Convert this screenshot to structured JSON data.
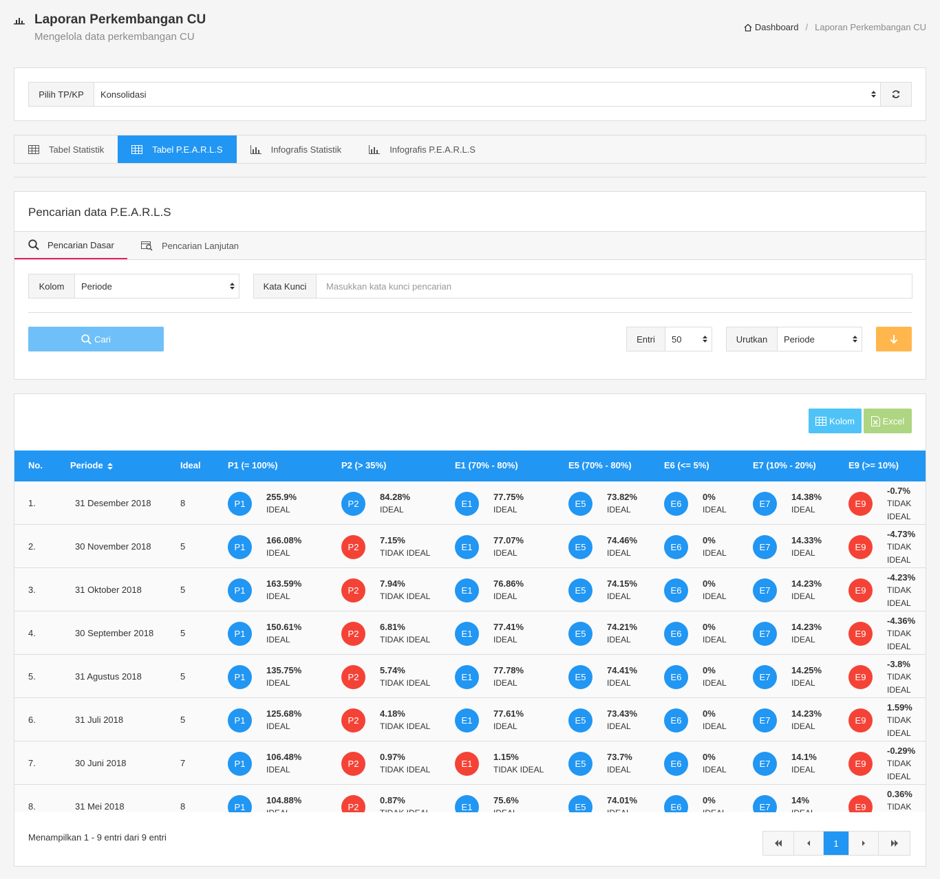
{
  "header": {
    "title": "Laporan Perkembangan CU",
    "subtitle": "Mengelola data perkembangan CU",
    "breadcrumb": {
      "home": "Dashboard",
      "current": "Laporan Perkembangan CU"
    }
  },
  "tpkp": {
    "label": "Pilih TP/KP",
    "value": "Konsolidasi"
  },
  "tabs": [
    {
      "label": "Tabel Statistik"
    },
    {
      "label": "Tabel P.E.A.R.L.S"
    },
    {
      "label": "Infografis Statistik"
    },
    {
      "label": "Infografis P.E.A.R.L.S"
    }
  ],
  "search": {
    "title": "Pencarian data P.E.A.R.L.S",
    "tab_basic": "Pencarian Dasar",
    "tab_advanced": "Pencarian Lanjutan",
    "kolom_label": "Kolom",
    "kolom_value": "Periode",
    "kata_label": "Kata Kunci",
    "kata_placeholder": "Masukkan kata kunci pencarian",
    "cari_label": "Cari",
    "entri_label": "Entri",
    "entri_value": "50",
    "urut_label": "Urutkan",
    "urut_value": "Periode"
  },
  "table": {
    "btn_kolom": "Kolom",
    "btn_excel": "Excel",
    "headers": {
      "no": "No.",
      "periode": "Periode",
      "ideal": "Ideal",
      "p1": "P1 (= 100%)",
      "p2": "P2 (> 35%)",
      "e1": "E1 (70% - 80%)",
      "e5": "E5 (70% - 80%)",
      "e6": "E6 (<= 5%)",
      "e7": "E7 (10% - 20%)",
      "e9": "E9 (>= 10%)"
    },
    "rows": [
      {
        "no": "1.",
        "periode": "31 Desember 2018",
        "ideal": "8",
        "ind": [
          [
            "P1",
            "255.9%",
            "IDEAL"
          ],
          [
            "P2",
            "84.28%",
            "IDEAL"
          ],
          [
            "E1",
            "77.75%",
            "IDEAL"
          ],
          [
            "E5",
            "73.82%",
            "IDEAL"
          ],
          [
            "E6",
            "0%",
            "IDEAL"
          ],
          [
            "E7",
            "14.38%",
            "IDEAL"
          ],
          [
            "E9",
            "-0.7%",
            "TIDAK IDEAL"
          ]
        ]
      },
      {
        "no": "2.",
        "periode": "30 November 2018",
        "ideal": "5",
        "ind": [
          [
            "P1",
            "166.08%",
            "IDEAL"
          ],
          [
            "P2",
            "7.15%",
            "TIDAK IDEAL"
          ],
          [
            "E1",
            "77.07%",
            "IDEAL"
          ],
          [
            "E5",
            "74.46%",
            "IDEAL"
          ],
          [
            "E6",
            "0%",
            "IDEAL"
          ],
          [
            "E7",
            "14.33%",
            "IDEAL"
          ],
          [
            "E9",
            "-4.73%",
            "TIDAK IDEAL"
          ]
        ]
      },
      {
        "no": "3.",
        "periode": "31 Oktober 2018",
        "ideal": "5",
        "ind": [
          [
            "P1",
            "163.59%",
            "IDEAL"
          ],
          [
            "P2",
            "7.94%",
            "TIDAK IDEAL"
          ],
          [
            "E1",
            "76.86%",
            "IDEAL"
          ],
          [
            "E5",
            "74.15%",
            "IDEAL"
          ],
          [
            "E6",
            "0%",
            "IDEAL"
          ],
          [
            "E7",
            "14.23%",
            "IDEAL"
          ],
          [
            "E9",
            "-4.23%",
            "TIDAK IDEAL"
          ]
        ]
      },
      {
        "no": "4.",
        "periode": "30 September 2018",
        "ideal": "5",
        "ind": [
          [
            "P1",
            "150.61%",
            "IDEAL"
          ],
          [
            "P2",
            "6.81%",
            "TIDAK IDEAL"
          ],
          [
            "E1",
            "77.41%",
            "IDEAL"
          ],
          [
            "E5",
            "74.21%",
            "IDEAL"
          ],
          [
            "E6",
            "0%",
            "IDEAL"
          ],
          [
            "E7",
            "14.23%",
            "IDEAL"
          ],
          [
            "E9",
            "-4.36%",
            "TIDAK IDEAL"
          ]
        ]
      },
      {
        "no": "5.",
        "periode": "31 Agustus 2018",
        "ideal": "5",
        "ind": [
          [
            "P1",
            "135.75%",
            "IDEAL"
          ],
          [
            "P2",
            "5.74%",
            "TIDAK IDEAL"
          ],
          [
            "E1",
            "77.78%",
            "IDEAL"
          ],
          [
            "E5",
            "74.41%",
            "IDEAL"
          ],
          [
            "E6",
            "0%",
            "IDEAL"
          ],
          [
            "E7",
            "14.25%",
            "IDEAL"
          ],
          [
            "E9",
            "-3.8%",
            "TIDAK IDEAL"
          ]
        ]
      },
      {
        "no": "6.",
        "periode": "31 Juli 2018",
        "ideal": "5",
        "ind": [
          [
            "P1",
            "125.68%",
            "IDEAL"
          ],
          [
            "P2",
            "4.18%",
            "TIDAK IDEAL"
          ],
          [
            "E1",
            "77.61%",
            "IDEAL"
          ],
          [
            "E5",
            "73.43%",
            "IDEAL"
          ],
          [
            "E6",
            "0%",
            "IDEAL"
          ],
          [
            "E7",
            "14.23%",
            "IDEAL"
          ],
          [
            "E9",
            "1.59%",
            "TIDAK IDEAL"
          ]
        ]
      },
      {
        "no": "7.",
        "periode": "30 Juni 2018",
        "ideal": "7",
        "ind": [
          [
            "P1",
            "106.48%",
            "IDEAL"
          ],
          [
            "P2",
            "0.97%",
            "TIDAK IDEAL"
          ],
          [
            "E1",
            "1.15%",
            "TIDAK IDEAL"
          ],
          [
            "E5",
            "73.7%",
            "IDEAL"
          ],
          [
            "E6",
            "0%",
            "IDEAL"
          ],
          [
            "E7",
            "14.1%",
            "IDEAL"
          ],
          [
            "E9",
            "-0.29%",
            "TIDAK IDEAL"
          ]
        ]
      },
      {
        "no": "8.",
        "periode": "31 Mei 2018",
        "ideal": "8",
        "ind": [
          [
            "P1",
            "104.88%",
            "IDEAL"
          ],
          [
            "P2",
            "0.87%",
            "TIDAK IDEAL"
          ],
          [
            "E1",
            "75.6%",
            "IDEAL"
          ],
          [
            "E5",
            "74.01%",
            "IDEAL"
          ],
          [
            "E6",
            "0%",
            "IDEAL"
          ],
          [
            "E7",
            "14%",
            "IDEAL"
          ],
          [
            "E9",
            "0.36%",
            "TIDAK IDEAL"
          ]
        ]
      }
    ]
  },
  "footer": {
    "info": "Menampilkan 1 - 9 entri dari 9 entri",
    "current_page": "1"
  },
  "colors": {
    "primary": "#2196f3",
    "danger": "#f44336",
    "warning": "#ffb74d",
    "success": "#aed581",
    "info": "#4fc3f7",
    "accent": "#e91e63"
  }
}
